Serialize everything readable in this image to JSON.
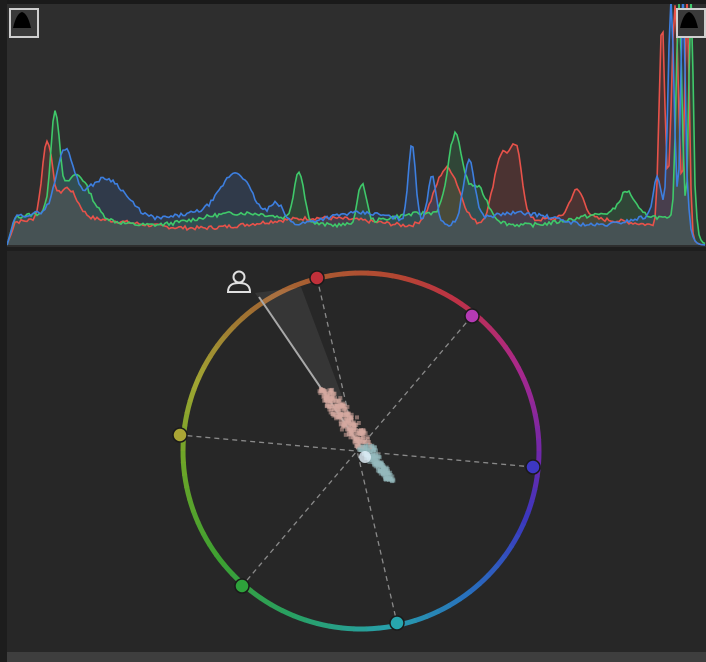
{
  "histogram": {
    "clip_left_icon": "shadow-clipping-icon",
    "clip_right_icon": "highlight-clipping-icon",
    "channel_colors": {
      "red": "#e8524a",
      "green": "#3fc96a",
      "blue": "#3d7fe0"
    }
  },
  "vectorscope": {
    "skin_tone_icon": "person-icon",
    "ring_colors": [
      "#c0352b",
      "#a0309a",
      "#3a36b8",
      "#27a2a8",
      "#2aa13a",
      "#a8a22a"
    ],
    "targets": [
      {
        "name": "red",
        "color": "#c0303a"
      },
      {
        "name": "magenta",
        "color": "#b43ab4"
      },
      {
        "name": "blue",
        "color": "#3d37c4"
      },
      {
        "name": "cyan",
        "color": "#27a6ae"
      },
      {
        "name": "green",
        "color": "#2ea23b"
      },
      {
        "name": "yellow",
        "color": "#aaa535"
      }
    ]
  }
}
